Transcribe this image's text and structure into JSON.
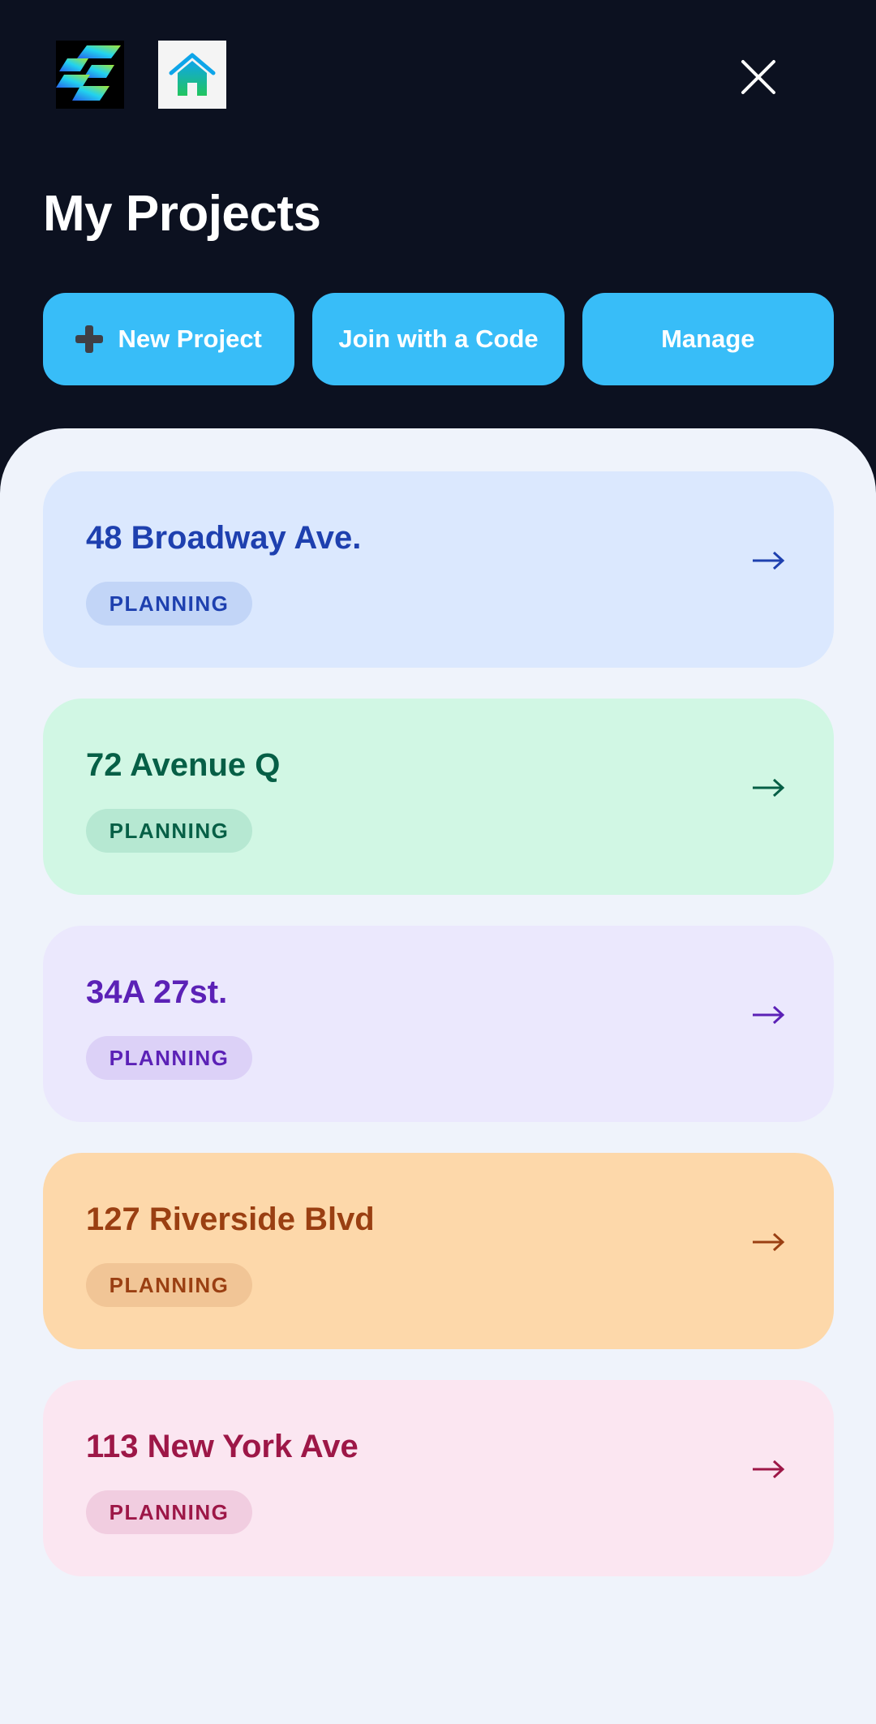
{
  "header": {
    "title": "My Projects",
    "close_icon": "close-icon",
    "logo_icon": "app-logo-icon",
    "home_icon": "home-icon"
  },
  "actions": {
    "new_project": "New Project",
    "new_project_icon": "plus-icon",
    "join_code": "Join with a Code",
    "manage": "Manage"
  },
  "projects": [
    {
      "name": "48 Broadway Ave.",
      "status": "PLANNING",
      "bg": "#dbe8fe",
      "fg": "#1e40af",
      "badge_bg": "#c2d5f7"
    },
    {
      "name": "72 Avenue Q",
      "status": "PLANNING",
      "bg": "#d1f7e4",
      "fg": "#065f46",
      "badge_bg": "#b6e8d2"
    },
    {
      "name": "34A 27st.",
      "status": "PLANNING",
      "bg": "#ebe8fd",
      "fg": "#5b21b6",
      "badge_bg": "#dcd1f7"
    },
    {
      "name": "127 Riverside Blvd",
      "status": "PLANNING",
      "bg": "#fdd8aa",
      "fg": "#9a3f12",
      "badge_bg": "#f1c596"
    },
    {
      "name": "113 New York Ave",
      "status": "PLANNING",
      "bg": "#fbe6f1",
      "fg": "#9d1747",
      "badge_bg": "#f1cde0"
    }
  ],
  "colors": {
    "header_bg": "#0c1120",
    "accent": "#38bdf8",
    "sheet_bg": "#eff3fb"
  }
}
